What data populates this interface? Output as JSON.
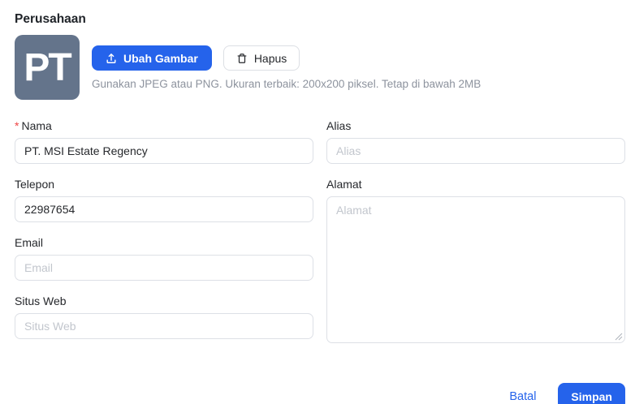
{
  "page": {
    "title": "Perusahaan"
  },
  "logo": {
    "initials": "PT",
    "upload_button": "Ubah Gambar",
    "delete_button": "Hapus",
    "hint": "Gunakan JPEG atau PNG. Ukuran terbaik: 200x200 piksel. Tetap di bawah 2MB"
  },
  "form": {
    "fields": {
      "nama": {
        "label": "Nama",
        "required_mark": "*",
        "value": "PT. MSI Estate Regency"
      },
      "alias": {
        "label": "Alias",
        "placeholder": "Alias"
      },
      "telepon": {
        "label": "Telepon",
        "value": "22987654"
      },
      "alamat": {
        "label": "Alamat",
        "placeholder": "Alamat"
      },
      "email": {
        "label": "Email",
        "placeholder": "Email"
      },
      "situs_web": {
        "label": "Situs Web",
        "placeholder": "Situs Web"
      }
    }
  },
  "footer": {
    "cancel_label": "Batal",
    "save_label": "Simpan"
  },
  "colors": {
    "primary_blue": "#2563eb",
    "avatar_background": "#64748b",
    "required_asterisk": "#ef4444",
    "hint_gray": "#8d939e",
    "input_border": "#dde0e6",
    "placeholder_gray": "#c2c6cd"
  }
}
